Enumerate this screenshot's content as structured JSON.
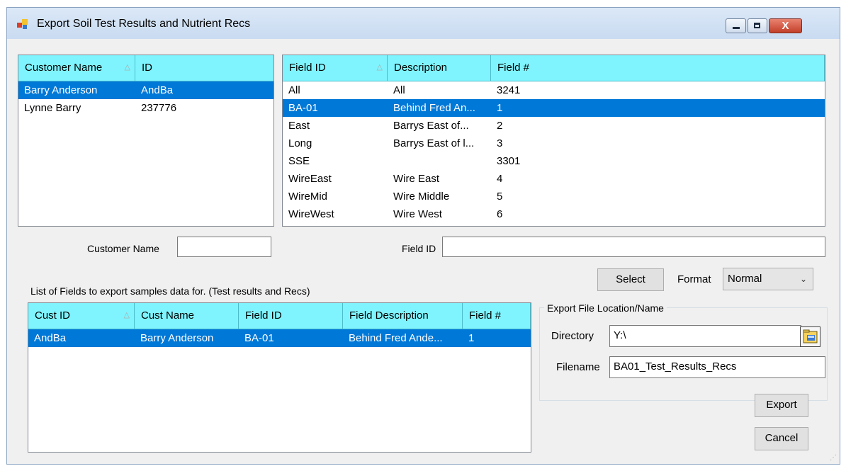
{
  "window": {
    "title": "Export Soil Test Results and Nutrient Recs",
    "close_label": "X"
  },
  "customers_grid": {
    "columns": [
      "Customer Name",
      "ID"
    ],
    "rows": [
      [
        "Barry Anderson",
        "AndBa"
      ],
      [
        "Lynne Barry",
        "237776"
      ]
    ],
    "selected_row": 0
  },
  "fields_grid": {
    "columns": [
      "Field ID",
      "Description",
      "Field #"
    ],
    "rows": [
      [
        "All",
        "All",
        "3241"
      ],
      [
        "BA-01",
        "Behind Fred An...",
        "1"
      ],
      [
        "East",
        "Barrys East of...",
        "2"
      ],
      [
        "Long",
        "Barrys East of l...",
        "3"
      ],
      [
        "SSE",
        "",
        "3301"
      ],
      [
        "WireEast",
        "Wire East",
        "4"
      ],
      [
        "WireMid",
        "Wire Middle",
        "5"
      ],
      [
        "WireWest",
        "Wire West",
        "6"
      ]
    ],
    "selected_row": 1
  },
  "filters": {
    "customer_name_label": "Customer Name",
    "customer_name_value": "",
    "field_id_label": "Field ID",
    "field_id_value": ""
  },
  "actions": {
    "select_label": "Select",
    "format_label": "Format",
    "format_value": "Normal",
    "export_label": "Export",
    "cancel_label": "Cancel"
  },
  "export_list": {
    "caption": "List of Fields to export samples data for. (Test results and Recs)",
    "columns": [
      "Cust ID",
      "Cust Name",
      "Field ID",
      "Field Description",
      "Field #"
    ],
    "rows": [
      [
        "AndBa",
        "Barry Anderson",
        "BA-01",
        "Behind Fred Ande...",
        "1"
      ]
    ],
    "selected_row": 0
  },
  "export_location": {
    "group_title": "Export File Location/Name",
    "directory_label": "Directory",
    "directory_value": "Y:\\",
    "filename_label": "Filename",
    "filename_value": "BA01_Test_Results_Recs"
  },
  "colors": {
    "header_bg": "#7ff4fe",
    "selection_bg": "#0078d7"
  }
}
